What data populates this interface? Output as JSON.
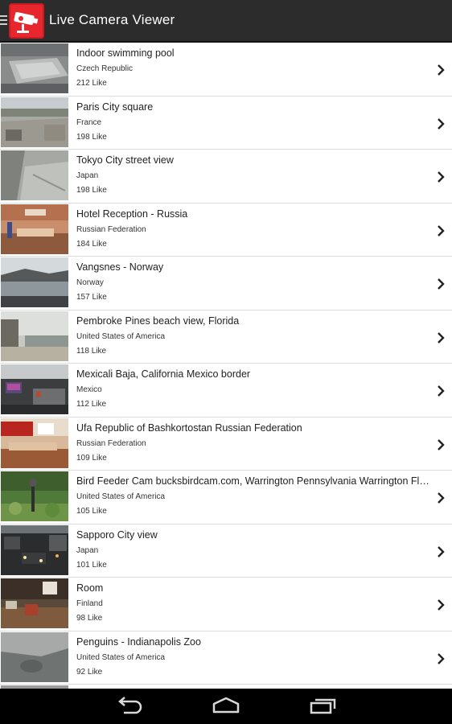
{
  "app": {
    "title": "Live Camera Viewer",
    "logo_icon": "camera-logo-icon",
    "accent_color": "#e8262d"
  },
  "cameras": [
    {
      "title": "Indoor swimming pool",
      "country": "Czech Republic",
      "likes": "212 Like"
    },
    {
      "title": "Paris City square",
      "country": "France",
      "likes": "198 Like"
    },
    {
      "title": "Tokyo City street view",
      "country": "Japan",
      "likes": "198 Like"
    },
    {
      "title": "Hotel Reception - Russia",
      "country": "Russian Federation",
      "likes": "184 Like"
    },
    {
      "title": "Vangsnes - Norway",
      "country": "Norway",
      "likes": "157 Like"
    },
    {
      "title": "Pembroke Pines beach view, Florida",
      "country": "United States of America",
      "likes": "118 Like"
    },
    {
      "title": "Mexicali Baja, California Mexico border",
      "country": "Mexico",
      "likes": "112 Like"
    },
    {
      "title": "Ufa Republic of Bashkortostan Russian Federation",
      "country": "Russian Federation",
      "likes": "109 Like"
    },
    {
      "title": "Bird Feeder Cam bucksbirdcam.com, Warrington Pennsylvania Warrington Flor…",
      "country": "United States of America",
      "likes": "105 Like"
    },
    {
      "title": "Sapporo City view",
      "country": "Japan",
      "likes": "101 Like"
    },
    {
      "title": "Room",
      "country": "Finland",
      "likes": "98 Like"
    },
    {
      "title": "Penguins - Indianapolis Zoo",
      "country": "United States of America",
      "likes": "92 Like"
    }
  ],
  "system_nav": {
    "back_icon": "back-icon",
    "home_icon": "home-icon",
    "recents_icon": "recent-apps-icon"
  }
}
